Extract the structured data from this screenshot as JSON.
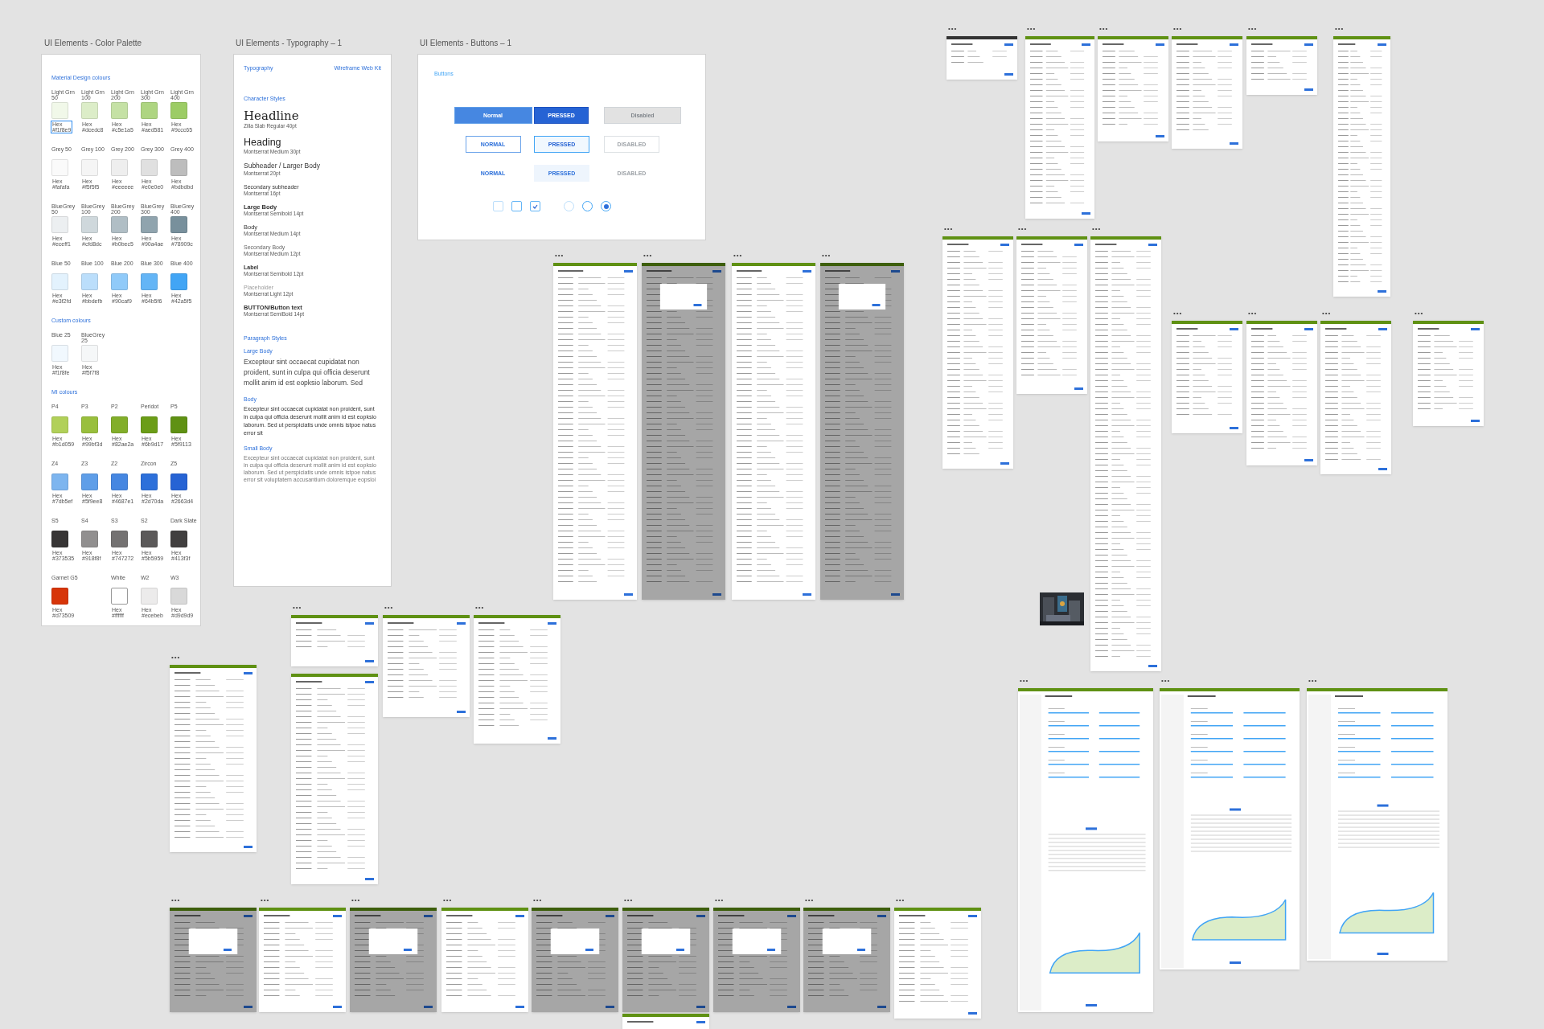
{
  "artboards": {
    "palette": {
      "title": "UI Elements - Color Palette",
      "sections": [
        {
          "title": "Material Design colours",
          "rows": [
            [
              {
                "kind": "swatch",
                "name": "Light Grn 50",
                "hex_label": "Hex",
                "hex": "#f1f8e9",
                "color": "#f1f8e9",
                "selected": true
              },
              {
                "kind": "swatch",
                "name": "Light Grn 100",
                "hex_label": "Hex",
                "hex": "#dcedc8",
                "color": "#dcedc8",
                "selected": false
              },
              {
                "kind": "swatch",
                "name": "Light Grn 200",
                "hex_label": "Hex",
                "hex": "#c5e1a5",
                "color": "#c5e1a5",
                "selected": false
              },
              {
                "kind": "swatch",
                "name": "Light Grn 300",
                "hex_label": "Hex",
                "hex": "#aed581",
                "color": "#aed581",
                "selected": false
              },
              {
                "kind": "swatch",
                "name": "Light Grn 400",
                "hex_label": "Hex",
                "hex": "#9ccc65",
                "color": "#9ccc65",
                "selected": false
              }
            ],
            [
              {
                "kind": "swatch",
                "name": "Grey 50",
                "hex_label": "Hex",
                "hex": "#fafafa",
                "color": "#fafafa",
                "selected": false
              },
              {
                "kind": "swatch",
                "name": "Grey 100",
                "hex_label": "Hex",
                "hex": "#f5f5f5",
                "color": "#f5f5f5",
                "selected": false
              },
              {
                "kind": "swatch",
                "name": "Grey 200",
                "hex_label": "Hex",
                "hex": "#eeeeee",
                "color": "#eeeeee",
                "selected": false
              },
              {
                "kind": "swatch",
                "name": "Grey 300",
                "hex_label": "Hex",
                "hex": "#e0e0e0",
                "color": "#e0e0e0",
                "selected": false
              },
              {
                "kind": "swatch",
                "name": "Grey 400",
                "hex_label": "Hex",
                "hex": "#bdbdbd",
                "color": "#bdbdbd",
                "selected": false
              }
            ],
            [
              {
                "kind": "swatch",
                "name": "BlueGrey 50",
                "hex_label": "Hex",
                "hex": "#eceff1",
                "color": "#eceff1",
                "selected": false
              },
              {
                "kind": "swatch",
                "name": "BlueGrey 100",
                "hex_label": "Hex",
                "hex": "#cfd8dc",
                "color": "#cfd8dc",
                "selected": false
              },
              {
                "kind": "swatch",
                "name": "BlueGrey 200",
                "hex_label": "Hex",
                "hex": "#b0bec5",
                "color": "#b0bec5",
                "selected": false
              },
              {
                "kind": "swatch",
                "name": "BlueGrey 300",
                "hex_label": "Hex",
                "hex": "#90a4ae",
                "color": "#90a4ae",
                "selected": false
              },
              {
                "kind": "swatch",
                "name": "BlueGrey 400",
                "hex_label": "Hex",
                "hex": "#78909c",
                "color": "#78909c",
                "selected": false
              }
            ],
            [
              {
                "kind": "swatch",
                "name": "Blue 50",
                "hex_label": "Hex",
                "hex": "#e3f2fd",
                "color": "#e3f2fd",
                "selected": false
              },
              {
                "kind": "swatch",
                "name": "Blue 100",
                "hex_label": "Hex",
                "hex": "#bbdefb",
                "color": "#bbdefb",
                "selected": false
              },
              {
                "kind": "swatch",
                "name": "Blue 200",
                "hex_label": "Hex",
                "hex": "#90caf9",
                "color": "#90caf9",
                "selected": false
              },
              {
                "kind": "swatch",
                "name": "Blue 300",
                "hex_label": "Hex",
                "hex": "#64b5f6",
                "color": "#64b5f6",
                "selected": false
              },
              {
                "kind": "swatch",
                "name": "Blue 400",
                "hex_label": "Hex",
                "hex": "#42a5f5",
                "color": "#42a5f5",
                "selected": false
              }
            ]
          ]
        },
        {
          "title": "Custom colours",
          "rows": [
            [
              {
                "kind": "swatch",
                "name": "Blue 25",
                "hex_label": "Hex",
                "hex": "#f1f8fe",
                "color": "#f1f8fe",
                "selected": false
              },
              {
                "kind": "swatch",
                "name": "BlueGrey 25",
                "hex_label": "Hex",
                "hex": "#f5f7f8",
                "color": "#f5f7f8",
                "selected": false
              }
            ]
          ]
        },
        {
          "title": "MI colours",
          "rows": [
            [
              {
                "kind": "swatch",
                "name": "P4",
                "hex_label": "Hex",
                "hex": "#b1d059",
                "color": "#b1d059",
                "selected": false
              },
              {
                "kind": "swatch",
                "name": "P3",
                "hex_label": "Hex",
                "hex": "#99bf3d",
                "color": "#99bf3d",
                "selected": false
              },
              {
                "kind": "swatch",
                "name": "P2",
                "hex_label": "Hex",
                "hex": "#82ae2a",
                "color": "#82ae2a",
                "selected": false
              },
              {
                "kind": "swatch",
                "name": "Peridot",
                "hex_label": "Hex",
                "hex": "#6b9d17",
                "color": "#6b9d17",
                "selected": false
              },
              {
                "kind": "swatch",
                "name": "P5",
                "hex_label": "Hex",
                "hex": "#5f9113",
                "color": "#5f9113",
                "selected": false
              }
            ],
            [
              {
                "kind": "swatch",
                "name": "Z4",
                "hex_label": "Hex",
                "hex": "#7db5ef",
                "color": "#7db5ef",
                "selected": false
              },
              {
                "kind": "swatch",
                "name": "Z3",
                "hex_label": "Hex",
                "hex": "#5f9ee8",
                "color": "#5f9ee8",
                "selected": false
              },
              {
                "kind": "swatch",
                "name": "Z2",
                "hex_label": "Hex",
                "hex": "#4687e1",
                "color": "#4687e1",
                "selected": false
              },
              {
                "kind": "swatch",
                "name": "Zircon",
                "hex_label": "Hex",
                "hex": "#2d70da",
                "color": "#2d70da",
                "selected": false
              },
              {
                "kind": "swatch",
                "name": "Z5",
                "hex_label": "Hex",
                "hex": "#2663d4",
                "color": "#2663d4",
                "selected": false
              }
            ],
            [
              {
                "kind": "swatch",
                "name": "S5",
                "hex_label": "Hex",
                "hex": "#373535",
                "color": "#373535",
                "selected": false
              },
              {
                "kind": "swatch",
                "name": "S4",
                "hex_label": "Hex",
                "hex": "#918f8f",
                "color": "#918f8f",
                "selected": false
              },
              {
                "kind": "swatch",
                "name": "S3",
                "hex_label": "Hex",
                "hex": "#747272",
                "color": "#747272",
                "selected": false
              },
              {
                "kind": "swatch",
                "name": "S2",
                "hex_label": "Hex",
                "hex": "#5b5959",
                "color": "#5b5959",
                "selected": false
              },
              {
                "kind": "swatch",
                "name": "Dark Slate",
                "hex_label": "Hex",
                "hex": "#413f3f",
                "color": "#413f3f",
                "selected": false
              }
            ],
            [
              {
                "kind": "swatch",
                "name": "Garnet G5",
                "hex_label": "Hex",
                "hex": "#d73509",
                "color": "#d73509",
                "selected": false
              },
              {
                "kind": "blank"
              },
              {
                "kind": "swatch",
                "name": "White",
                "hex_label": "Hex",
                "hex": "#ffffff",
                "color": "#ffffff",
                "selected": false
              },
              {
                "kind": "swatch",
                "name": "W2",
                "hex_label": "Hex",
                "hex": "#ecebeb",
                "color": "#ecebeb",
                "selected": false
              },
              {
                "kind": "swatch",
                "name": "W3",
                "hex_label": "Hex",
                "hex": "#d9d9d9",
                "color": "#d9d9d9",
                "selected": false
              }
            ]
          ]
        }
      ]
    },
    "typography": {
      "title": "UI Elements - Typography – 1",
      "header_left": "Typography",
      "header_right": "Wireframe Web Kit",
      "character_title": "Character Styles",
      "styles": [
        {
          "kind": "headline",
          "sample": "Headline",
          "caption": "Zilla Slab Regular 40pt"
        },
        {
          "kind": "heading",
          "sample": "Heading",
          "caption": "Montserrat Medium 30pt"
        },
        {
          "kind": "subheader",
          "sample": "Subheader / Larger Body",
          "caption": "Montserrat 20pt"
        },
        {
          "kind": "secondary_subheader",
          "sample": "Secondary subheader",
          "caption": "Montserrat 16pt"
        },
        {
          "kind": "large_body",
          "sample": "Large Body",
          "caption": "Montserrat Semibold 14pt"
        },
        {
          "kind": "body",
          "sample": "Body",
          "caption": "Montserrat Medium 14pt"
        },
        {
          "kind": "secondary_body",
          "sample": "Secondary Body",
          "caption": "Montserrat Medium 12pt"
        },
        {
          "kind": "label",
          "sample": "Label",
          "caption": "Montserrat Semibold 12pt"
        },
        {
          "kind": "placeholder",
          "sample": "Placeholder",
          "caption": "Montserrat Light 12pt"
        },
        {
          "kind": "button_text",
          "sample": "BUTTON/Button text",
          "caption": "Montserrat SemiBold 14pt"
        }
      ],
      "paragraph_title": "Paragraph Styles",
      "paragraphs": [
        {
          "kind": "large",
          "label": "Large Body",
          "text": "Excepteur sint occaecat cupidatat non proident, sunt in culpa qui officia deserunt mollit anim id est eopksio laborum. Sed"
        },
        {
          "kind": "body",
          "label": "Body",
          "text": "Excepteur sint occaecat cupidatat non proident, sunt in culpa qui officia deserunt mollit anim id est eopksio laborum. Sed ut perspiciatis unde omnis istpoe natus error sit"
        },
        {
          "kind": "small",
          "label": "Small Body",
          "text": "Excepteur sint occaecat cupidatat non proident, sunt in culpa qui officia deserunt mollit anim id est eopksio laborum. Sed ut perspiciatis unde omnis istpoe natus error sit voluptatem accusantium doloremque eopsloi"
        }
      ]
    },
    "buttons": {
      "title": "UI Elements - Buttons – 1",
      "section": "Buttons",
      "rows": [
        {
          "kind": "filled",
          "buttons": [
            {
              "label": "Normal",
              "pressed": false,
              "disabled": false
            },
            {
              "label": "PRESSED",
              "pressed": true,
              "disabled": false
            },
            {
              "label": "Disabled",
              "pressed": false,
              "disabled": true
            }
          ]
        },
        {
          "kind": "outline",
          "buttons": [
            {
              "label": "NORMAL",
              "pressed": false,
              "disabled": false
            },
            {
              "label": "PRESSED",
              "pressed": true,
              "disabled": false
            },
            {
              "label": "DISABLED",
              "pressed": false,
              "disabled": true
            }
          ]
        },
        {
          "kind": "text",
          "buttons": [
            {
              "label": "NORMAL",
              "pressed": false,
              "disabled": false
            },
            {
              "label": "PRESSED",
              "pressed": true,
              "disabled": false
            },
            {
              "label": "DISABLED",
              "pressed": false,
              "disabled": true
            }
          ]
        }
      ],
      "checkboxes": [
        {
          "checked": false,
          "disabled": true
        },
        {
          "checked": false,
          "disabled": false
        },
        {
          "checked": true,
          "disabled": false
        }
      ],
      "radios": [
        {
          "selected": false,
          "disabled": true
        },
        {
          "selected": false,
          "disabled": false
        },
        {
          "selected": true,
          "disabled": false
        }
      ]
    }
  },
  "thumbnails": [
    {
      "label": "•••",
      "kind": "wireframe",
      "dark_header": true,
      "dimmed": false
    },
    {
      "label": "•••",
      "kind": "wireframe",
      "dark_header": false,
      "dimmed": false
    },
    {
      "label": "•••",
      "kind": "wireframe",
      "dark_header": false,
      "dimmed": false
    },
    {
      "label": "•••",
      "kind": "wireframe",
      "dark_header": false,
      "dimmed": false
    },
    {
      "label": "•••",
      "kind": "wireframe",
      "dark_header": false,
      "dimmed": false
    },
    {
      "label": "•••",
      "kind": "wireframe",
      "dark_header": false,
      "dimmed": false
    },
    {
      "label": "•••",
      "kind": "wireframe",
      "dark_header": false,
      "dimmed": false
    },
    {
      "label": "•••",
      "kind": "wireframe",
      "dark_header": false,
      "dimmed": false
    },
    {
      "label": "•••",
      "kind": "wireframe",
      "dark_header": false,
      "dimmed": false
    },
    {
      "label": "•••",
      "kind": "wireframe",
      "dark_header": false,
      "dimmed": false
    },
    {
      "label": "•••",
      "kind": "wireframe",
      "dark_header": false,
      "dimmed": false
    },
    {
      "label": "•••",
      "kind": "wireframe",
      "dark_header": false,
      "dimmed": false
    },
    {
      "label": "•••",
      "kind": "wireframe",
      "dark_header": false,
      "dimmed": false
    },
    {
      "label": "•••",
      "kind": "wireframe",
      "dark_header": false,
      "dimmed": false
    },
    {
      "label": "•••",
      "kind": "wireframe",
      "dark_header": false,
      "dimmed": true
    },
    {
      "label": "•••",
      "kind": "wireframe",
      "dark_header": false,
      "dimmed": false
    },
    {
      "label": "•••",
      "kind": "wireframe",
      "dark_header": false,
      "dimmed": true
    },
    {
      "label": "•••",
      "kind": "wireframe",
      "dark_header": false,
      "dimmed": false
    },
    {
      "kind": "wireframe",
      "dark_header": false,
      "dimmed": false
    },
    {
      "label": "•••",
      "kind": "wireframe",
      "dark_header": false,
      "dimmed": false
    },
    {
      "label": "•••",
      "kind": "wireframe",
      "dark_header": false,
      "dimmed": false
    },
    {
      "label": "•••",
      "kind": "wireframe",
      "dark_header": false,
      "dimmed": false
    },
    {
      "label": "•••",
      "kind": "wireframe",
      "dark_header": false,
      "dimmed": true
    },
    {
      "label": "•••",
      "kind": "wireframe",
      "dark_header": false,
      "dimmed": false
    },
    {
      "label": "•••",
      "kind": "wireframe",
      "dark_header": false,
      "dimmed": true
    },
    {
      "label": "•••",
      "kind": "wireframe",
      "dark_header": false,
      "dimmed": false
    },
    {
      "label": "•••",
      "kind": "wireframe",
      "dark_header": false,
      "dimmed": true
    },
    {
      "label": "•••",
      "kind": "wireframe",
      "dark_header": false,
      "dimmed": true
    },
    {
      "label": "•••",
      "kind": "wireframe",
      "dark_header": false,
      "dimmed": true
    },
    {
      "label": "•••",
      "kind": "wireframe",
      "dark_header": false,
      "dimmed": true
    },
    {
      "label": "•••",
      "kind": "wireframe",
      "dark_header": false,
      "dimmed": false
    },
    {
      "kind": "wireframe",
      "dark_header": false,
      "dimmed": false
    },
    {
      "label": "•••",
      "kind": "analysis",
      "dark_header": false,
      "dimmed": false
    },
    {
      "label": "•••",
      "kind": "analysis",
      "dark_header": false,
      "dimmed": false
    },
    {
      "label": "•••",
      "kind": "analysis",
      "dark_header": false,
      "dimmed": false
    },
    {
      "kind": "picture"
    }
  ]
}
